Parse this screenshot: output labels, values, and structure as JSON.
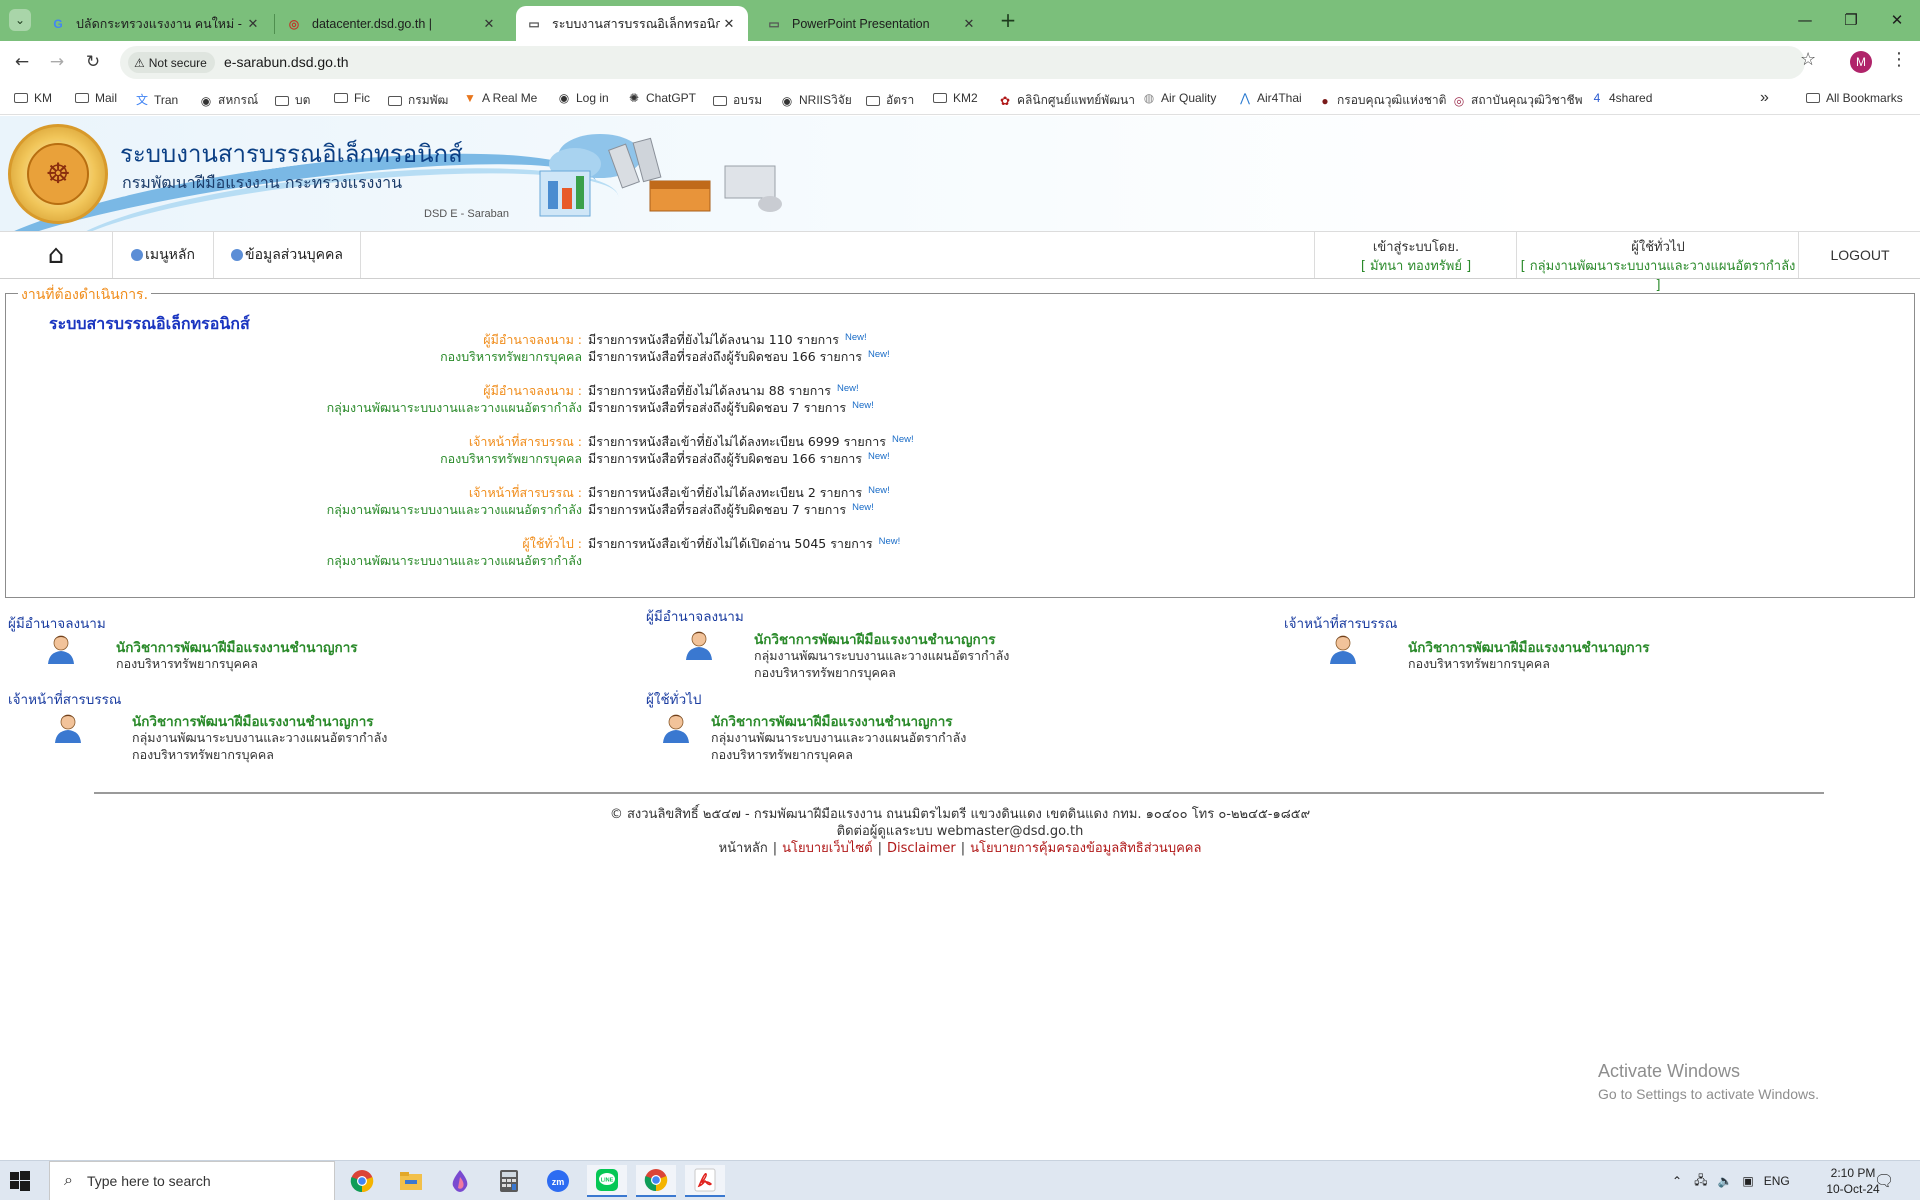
{
  "browser": {
    "tabs": [
      {
        "title": "ปลัดกระทรวงแรงงาน คนใหม่ - ค้นหาด้วย Google",
        "favicon": "google-icon",
        "active": false
      },
      {
        "title": "datacenter.dsd.go.th |",
        "favicon": "site-icon",
        "active": false
      },
      {
        "title": "ระบบงานสารบรรณอิเล็กทรอนิกส์ - T",
        "favicon": "document-icon",
        "active": true
      },
      {
        "title": "PowerPoint Presentation",
        "favicon": "document-icon",
        "active": false
      }
    ],
    "new_tab": "+",
    "not_secure": "Not secure",
    "url": "e-sarabun.dsd.go.th",
    "profile_initial": "M",
    "bookmarks": [
      "KM",
      "Mail",
      "Tran",
      "สหกรณ์",
      "บต",
      "Fic",
      "กรมพัฒ",
      "A Real Me",
      "Log in",
      "ChatGPT",
      "อบรม",
      "NRIISวิจัย",
      "อัตรา",
      "KM2",
      "คลินิกศูนย์แพทย์พัฒนา",
      "Air Quality",
      "Air4Thai",
      "กรอบคุณวุฒิแห่งชาติ",
      "สถาบันคุณวุฒิวิชาชีพ",
      "4shared"
    ],
    "all_bookmarks": "All Bookmarks",
    "more_bookmarks": "»"
  },
  "site": {
    "title": "ระบบงานสารบรรณอิเล็กทรอนิกส์",
    "subtitle": "กรมพัฒนาฝีมือแรงงาน กระทรวงแรงงาน",
    "tagline": "DSD E - Saraban"
  },
  "menu": {
    "main": "เมนูหลัก",
    "personal": "ข้อมูลส่วนบุคคล",
    "login_label": "เข้าสู่ระบบโดย.",
    "login_user": "[ มัทนา ทองทรัพย์ ]",
    "role_label": "ผู้ใช้ทั่วไป",
    "role_group": "[ กลุ่มงานพัฒนาระบบงานและวางแผนอัตรากำลัง ]",
    "logout": "LOGOUT"
  },
  "tasks": {
    "legend": "งานที่ต้องดำเนินการ.",
    "heading": "ระบบสารบรรณอิเล็กทรอนิกส์",
    "new_label": "New!",
    "rows": [
      {
        "label": "ผู้มีอำนาจลงนาม :",
        "text": "มีรายการหนังสือที่ยังไม่ได้ลงนาม 110 รายการ",
        "new": true
      },
      {
        "label": "กองบริหารทรัพยากรบุคคล",
        "text": "มีรายการหนังสือที่รอส่งถึงผู้รับผิดชอบ 166 รายการ",
        "new": true
      },
      {
        "label": "ผู้มีอำนาจลงนาม :",
        "text": "มีรายการหนังสือที่ยังไม่ได้ลงนาม 88 รายการ",
        "new": true
      },
      {
        "label": "กลุ่มงานพัฒนาระบบงานและวางแผนอัตรากำลัง",
        "text": "มีรายการหนังสือที่รอส่งถึงผู้รับผิดชอบ 7 รายการ",
        "new": true
      },
      {
        "label": "เจ้าหน้าที่สารบรรณ :",
        "text": "มีรายการหนังสือเข้าที่ยังไม่ได้ลงทะเบียน 6999 รายการ",
        "new": true
      },
      {
        "label": "กองบริหารทรัพยากรบุคคล",
        "text": "มีรายการหนังสือที่รอส่งถึงผู้รับผิดชอบ 166 รายการ",
        "new": true
      },
      {
        "label": "เจ้าหน้าที่สารบรรณ :",
        "text": "มีรายการหนังสือเข้าที่ยังไม่ได้ลงทะเบียน 2 รายการ",
        "new": true
      },
      {
        "label": "กลุ่มงานพัฒนาระบบงานและวางแผนอัตรากำลัง",
        "text": "มีรายการหนังสือที่รอส่งถึงผู้รับผิดชอบ 7 รายการ",
        "new": true
      },
      {
        "label": "ผู้ใช้ทั่วไป :",
        "text": "มีรายการหนังสือเข้าที่ยังไม่ได้เปิดอ่าน 5045 รายการ",
        "new": true
      },
      {
        "label": "กลุ่มงานพัฒนาระบบงานและวางแผนอัตรากำลัง",
        "text": "",
        "new": false
      }
    ]
  },
  "roles": [
    {
      "role": "ผู้มีอำนาจลงนาม",
      "position": "นักวิชาการพัฒนาฝีมือแรงงานชำนาญการ",
      "org1": "กองบริหารทรัพยากรบุคคล",
      "org2": ""
    },
    {
      "role": "ผู้มีอำนาจลงนาม",
      "position": "นักวิชาการพัฒนาฝีมือแรงงานชำนาญการ",
      "org1": "กลุ่มงานพัฒนาระบบงานและวางแผนอัตรากำลัง",
      "org2": "กองบริหารทรัพยากรบุคคล"
    },
    {
      "role": "เจ้าหน้าที่สารบรรณ",
      "position": "นักวิชาการพัฒนาฝีมือแรงงานชำนาญการ",
      "org1": "กองบริหารทรัพยากรบุคคล",
      "org2": ""
    },
    {
      "role": "เจ้าหน้าที่สารบรรณ",
      "position": "นักวิชาการพัฒนาฝีมือแรงงานชำนาญการ",
      "org1": "กลุ่มงานพัฒนาระบบงานและวางแผนอัตรากำลัง",
      "org2": "กองบริหารทรัพยากรบุคคล"
    },
    {
      "role": "ผู้ใช้ทั่วไป",
      "position": "นักวิชาการพัฒนาฝีมือแรงงานชำนาญการ",
      "org1": "กลุ่มงานพัฒนาระบบงานและวางแผนอัตรากำลัง",
      "org2": "กองบริหารทรัพยากรบุคคล"
    }
  ],
  "footer": {
    "copyright": "© สงวนลิขสิทธิ์ ๒๕๔๗ - กรมพัฒนาฝีมือแรงงาน ถนนมิตรไมตรี แขวงดินแดง เขตดินแดง กทม. ๑๐๔๐๐ โทร ๐-๒๒๔๕-๑๘๕๙",
    "contact": "ติดต่อผู้ดูแลระบบ webmaster@dsd.go.th",
    "links": [
      "หน้าหลัก",
      "นโยบายเว็บไซต์",
      "Disclaimer",
      "นโยบายการคุ้มครองข้อมูลสิทธิส่วนบุคคล"
    ]
  },
  "windows": {
    "activate_title": "Activate Windows",
    "activate_sub": "Go to Settings to activate Windows.",
    "search_placeholder": "Type here to search",
    "lang": "ENG",
    "time": "2:10 PM",
    "date": "10-Oct-24"
  },
  "colors": {
    "tabbar": "#7bbf7b",
    "legend_orange": "#f08c1a",
    "label_green": "#2a8a2a",
    "heading_blue": "#1a35c0",
    "link_red": "#b01818"
  }
}
